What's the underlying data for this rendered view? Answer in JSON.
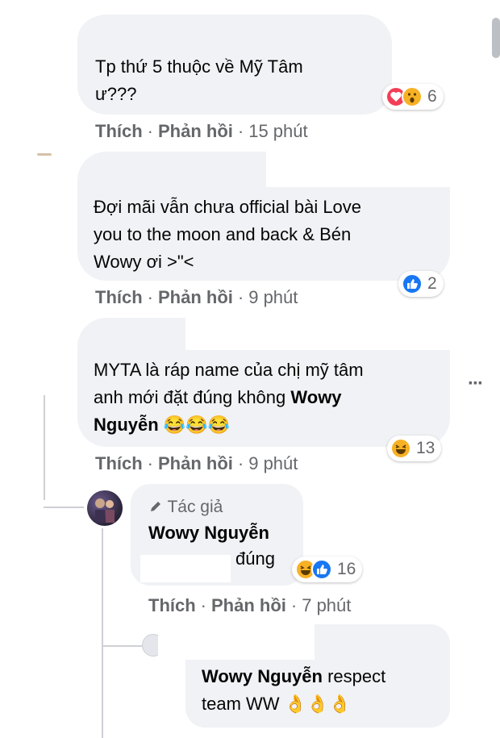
{
  "actions": {
    "like": "Thích",
    "reply": "Phản hồi",
    "dot": "·"
  },
  "comments": [
    {
      "text_line1": "Tp thứ 5 thuộc về Mỹ Tâm",
      "text_line2": "ư???",
      "reaction_count": "6",
      "time": "15 phút",
      "reactions": [
        "heart-reaction",
        "wow-reaction"
      ]
    },
    {
      "text_line1": "Đợi mãi vẫn chưa official bài Love",
      "text_line2": "you to the moon and back & Bén",
      "text_line3": "Wowy ơi >\"<",
      "reaction_count": "2",
      "time": "9 phút",
      "reactions": [
        "like-reaction"
      ]
    },
    {
      "text_line1": "MYTA là ráp name của chị mỹ tâm",
      "text_line2": "anh mới đặt đúng không",
      "mention_part1": "Wowy",
      "mention_part2": "Nguyễn",
      "emojis": "😂😂😂",
      "reaction_count": "13",
      "time": "9 phút",
      "reactions": [
        "haha-reaction"
      ]
    }
  ],
  "reply_author": {
    "badge_icon": "pencil-icon",
    "badge": "Tác giả",
    "name": "Wowy Nguyễn",
    "text": "đúng",
    "reaction_count": "16",
    "time": "7 phút",
    "reactions": [
      "haha-reaction",
      "like-reaction"
    ]
  },
  "reply_last": {
    "mention": "Wowy Nguyễn",
    "text_part1": "respect",
    "text_part2": "team WW",
    "emojis": "👌👌👌"
  },
  "more_options": "···",
  "colors": {
    "bubble": "#f0f2f5",
    "meta": "#65676b",
    "like_blue": "#1877f2",
    "heart_red": "#f33e58",
    "emoji_yellow": "#f7b125"
  }
}
